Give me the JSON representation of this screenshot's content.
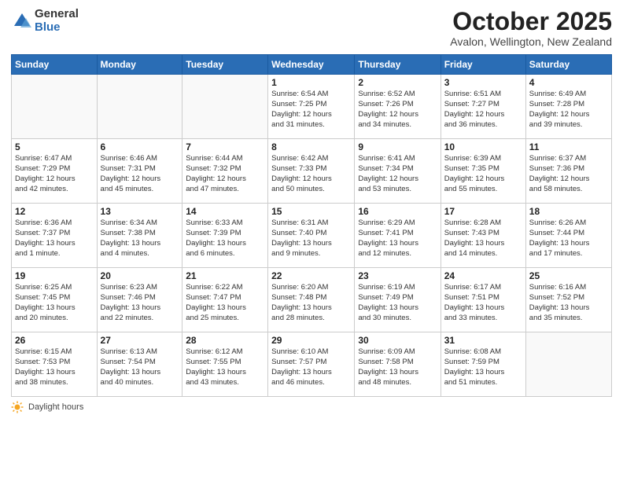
{
  "header": {
    "logo_general": "General",
    "logo_blue": "Blue",
    "title": "October 2025",
    "location": "Avalon, Wellington, New Zealand"
  },
  "weekdays": [
    "Sunday",
    "Monday",
    "Tuesday",
    "Wednesday",
    "Thursday",
    "Friday",
    "Saturday"
  ],
  "weeks": [
    [
      {
        "num": "",
        "info": ""
      },
      {
        "num": "",
        "info": ""
      },
      {
        "num": "",
        "info": ""
      },
      {
        "num": "1",
        "info": "Sunrise: 6:54 AM\nSunset: 7:25 PM\nDaylight: 12 hours\nand 31 minutes."
      },
      {
        "num": "2",
        "info": "Sunrise: 6:52 AM\nSunset: 7:26 PM\nDaylight: 12 hours\nand 34 minutes."
      },
      {
        "num": "3",
        "info": "Sunrise: 6:51 AM\nSunset: 7:27 PM\nDaylight: 12 hours\nand 36 minutes."
      },
      {
        "num": "4",
        "info": "Sunrise: 6:49 AM\nSunset: 7:28 PM\nDaylight: 12 hours\nand 39 minutes."
      }
    ],
    [
      {
        "num": "5",
        "info": "Sunrise: 6:47 AM\nSunset: 7:29 PM\nDaylight: 12 hours\nand 42 minutes."
      },
      {
        "num": "6",
        "info": "Sunrise: 6:46 AM\nSunset: 7:31 PM\nDaylight: 12 hours\nand 45 minutes."
      },
      {
        "num": "7",
        "info": "Sunrise: 6:44 AM\nSunset: 7:32 PM\nDaylight: 12 hours\nand 47 minutes."
      },
      {
        "num": "8",
        "info": "Sunrise: 6:42 AM\nSunset: 7:33 PM\nDaylight: 12 hours\nand 50 minutes."
      },
      {
        "num": "9",
        "info": "Sunrise: 6:41 AM\nSunset: 7:34 PM\nDaylight: 12 hours\nand 53 minutes."
      },
      {
        "num": "10",
        "info": "Sunrise: 6:39 AM\nSunset: 7:35 PM\nDaylight: 12 hours\nand 55 minutes."
      },
      {
        "num": "11",
        "info": "Sunrise: 6:37 AM\nSunset: 7:36 PM\nDaylight: 12 hours\nand 58 minutes."
      }
    ],
    [
      {
        "num": "12",
        "info": "Sunrise: 6:36 AM\nSunset: 7:37 PM\nDaylight: 13 hours\nand 1 minute."
      },
      {
        "num": "13",
        "info": "Sunrise: 6:34 AM\nSunset: 7:38 PM\nDaylight: 13 hours\nand 4 minutes."
      },
      {
        "num": "14",
        "info": "Sunrise: 6:33 AM\nSunset: 7:39 PM\nDaylight: 13 hours\nand 6 minutes."
      },
      {
        "num": "15",
        "info": "Sunrise: 6:31 AM\nSunset: 7:40 PM\nDaylight: 13 hours\nand 9 minutes."
      },
      {
        "num": "16",
        "info": "Sunrise: 6:29 AM\nSunset: 7:41 PM\nDaylight: 13 hours\nand 12 minutes."
      },
      {
        "num": "17",
        "info": "Sunrise: 6:28 AM\nSunset: 7:43 PM\nDaylight: 13 hours\nand 14 minutes."
      },
      {
        "num": "18",
        "info": "Sunrise: 6:26 AM\nSunset: 7:44 PM\nDaylight: 13 hours\nand 17 minutes."
      }
    ],
    [
      {
        "num": "19",
        "info": "Sunrise: 6:25 AM\nSunset: 7:45 PM\nDaylight: 13 hours\nand 20 minutes."
      },
      {
        "num": "20",
        "info": "Sunrise: 6:23 AM\nSunset: 7:46 PM\nDaylight: 13 hours\nand 22 minutes."
      },
      {
        "num": "21",
        "info": "Sunrise: 6:22 AM\nSunset: 7:47 PM\nDaylight: 13 hours\nand 25 minutes."
      },
      {
        "num": "22",
        "info": "Sunrise: 6:20 AM\nSunset: 7:48 PM\nDaylight: 13 hours\nand 28 minutes."
      },
      {
        "num": "23",
        "info": "Sunrise: 6:19 AM\nSunset: 7:49 PM\nDaylight: 13 hours\nand 30 minutes."
      },
      {
        "num": "24",
        "info": "Sunrise: 6:17 AM\nSunset: 7:51 PM\nDaylight: 13 hours\nand 33 minutes."
      },
      {
        "num": "25",
        "info": "Sunrise: 6:16 AM\nSunset: 7:52 PM\nDaylight: 13 hours\nand 35 minutes."
      }
    ],
    [
      {
        "num": "26",
        "info": "Sunrise: 6:15 AM\nSunset: 7:53 PM\nDaylight: 13 hours\nand 38 minutes."
      },
      {
        "num": "27",
        "info": "Sunrise: 6:13 AM\nSunset: 7:54 PM\nDaylight: 13 hours\nand 40 minutes."
      },
      {
        "num": "28",
        "info": "Sunrise: 6:12 AM\nSunset: 7:55 PM\nDaylight: 13 hours\nand 43 minutes."
      },
      {
        "num": "29",
        "info": "Sunrise: 6:10 AM\nSunset: 7:57 PM\nDaylight: 13 hours\nand 46 minutes."
      },
      {
        "num": "30",
        "info": "Sunrise: 6:09 AM\nSunset: 7:58 PM\nDaylight: 13 hours\nand 48 minutes."
      },
      {
        "num": "31",
        "info": "Sunrise: 6:08 AM\nSunset: 7:59 PM\nDaylight: 13 hours\nand 51 minutes."
      },
      {
        "num": "",
        "info": ""
      }
    ]
  ],
  "footer": {
    "daylight_label": "Daylight hours"
  }
}
